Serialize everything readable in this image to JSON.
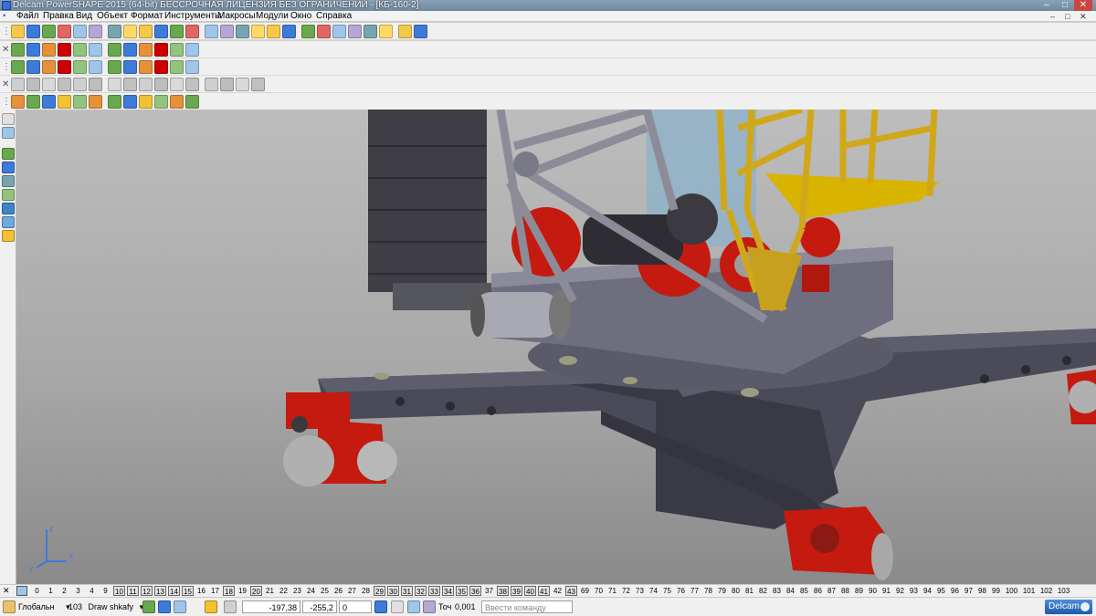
{
  "window": {
    "title": "Delcam PowerSHAPE 2015 (64-bit) БЕССРОЧНАЯ ЛИЦЕНЗИЯ БЕЗ ОГРАНИЧЕНИЙ - [КБ-160-2]",
    "minimize": "–",
    "maximize": "□",
    "close": "✕"
  },
  "menu": {
    "items": [
      "Файл",
      "Правка",
      "Вид",
      "Объект",
      "Формат",
      "Инструменты",
      "Макросы",
      "Модули",
      "Окно",
      "Справка"
    ],
    "window_controls": [
      "–",
      "□",
      "✕"
    ]
  },
  "toolbars": [
    {
      "name": "main-toolbar",
      "count": 26,
      "colors": [
        "#f3c84b",
        "#3d7bd9",
        "#6aa84f",
        "#e06666",
        "#9fc5e8",
        "#b4a7d6",
        "#76a5af",
        "#ffd966"
      ]
    },
    {
      "name": "view-toolbar",
      "count": 12,
      "colors": [
        "#6aa84f",
        "#3d7bd9",
        "#e69138",
        "#cc0000",
        "#93c47d",
        "#9fc5e8"
      ]
    },
    {
      "name": "surface-toolbar",
      "count": 16,
      "colors": [
        "#cfcfcf",
        "#bdbdbd",
        "#d9d9d9",
        "#c0c0c0"
      ]
    },
    {
      "name": "solid-toolbar",
      "count": 12,
      "colors": [
        "#e69138",
        "#6aa84f",
        "#3d7bd9",
        "#f1c232",
        "#93c47d"
      ]
    }
  ],
  "left_tools": {
    "count": 9,
    "colors": [
      "#e0e0e0",
      "#9fc5e8",
      "#6aa84f",
      "#3d7bd9",
      "#76a5af",
      "#93c47d",
      "#3d85c6",
      "#6fa8dc",
      "#f1c232"
    ]
  },
  "viewport": {
    "axis": {
      "x": "x",
      "y": "y",
      "z": "z"
    },
    "colors": {
      "steel": "#4a4a58",
      "steel_light": "#5d5d6c",
      "crane_red": "#c41a10",
      "crane_yellow": "#d1a71a",
      "cab_grey": "#7d7d7d"
    }
  },
  "levels": {
    "icon": "levels-icon",
    "items": [
      "0",
      "1",
      "2",
      "3",
      "4",
      "9",
      "10",
      "11",
      "12",
      "13",
      "14",
      "15",
      "16",
      "17",
      "18",
      "19",
      "20",
      "21",
      "22",
      "23",
      "24",
      "25",
      "26",
      "27",
      "28",
      "29",
      "30",
      "31",
      "32",
      "33",
      "34",
      "35",
      "36",
      "37",
      "38",
      "39",
      "40",
      "41",
      "42",
      "43",
      "69",
      "70",
      "71",
      "72",
      "73",
      "74",
      "75",
      "76",
      "77",
      "78",
      "79",
      "80",
      "81",
      "82",
      "83",
      "84",
      "85",
      "86",
      "87",
      "88",
      "89",
      "90",
      "91",
      "92",
      "93",
      "94",
      "95",
      "96",
      "97",
      "98",
      "99",
      "100",
      "101",
      "102",
      "103"
    ],
    "active": [
      "10",
      "11",
      "12",
      "13",
      "14",
      "15",
      "18",
      "20",
      "29",
      "30",
      "31",
      "32",
      "33",
      "34",
      "35",
      "36",
      "38",
      "39",
      "40",
      "41",
      "43"
    ]
  },
  "status": {
    "workplane": "Глобальн",
    "workplane_arrow": "▾",
    "layer_number": "103",
    "layer_name": "Draw shkafy",
    "layer_arrow": "▾",
    "coord_x": "-197,38",
    "coord_y": "-255,2",
    "coord_z": "0",
    "tolerance_label": "Точ",
    "tolerance_value": "0,001",
    "command_placeholder": "Ввести команду",
    "logo": "Delcam"
  }
}
